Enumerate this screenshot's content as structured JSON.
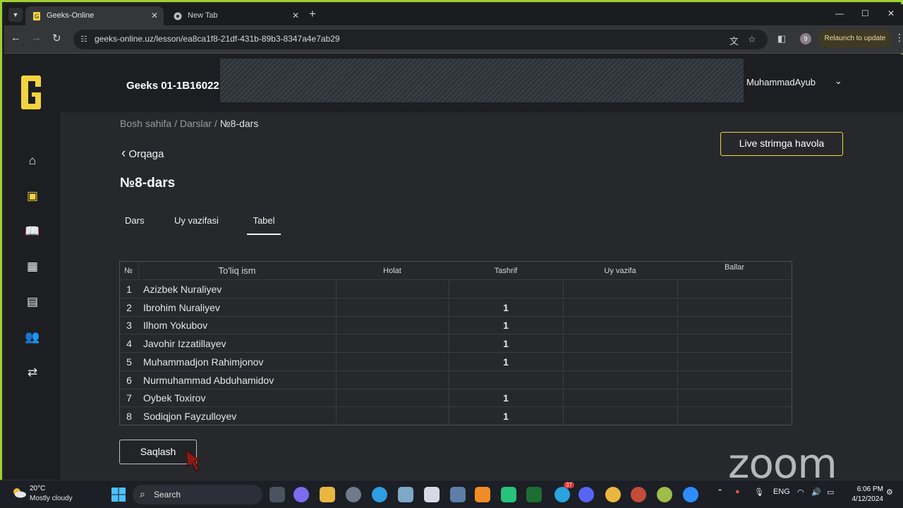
{
  "browser": {
    "tabs": [
      {
        "title": "Geeks-Online",
        "active": true
      },
      {
        "title": "New Tab",
        "active": false
      }
    ],
    "url": "geeks-online.uz/lesson/ea8ca1f8-21df-431b-89b3-8347a4e7ab29",
    "profile_badge": "9",
    "relaunch_label": "Relaunch to update"
  },
  "header": {
    "group_name": "Geeks 01-1B16022",
    "username": "MuhammadAyub"
  },
  "breadcrumb": {
    "home": "Bosh sahifa",
    "lessons": "Darslar",
    "current": "№8-dars",
    "separator": "/"
  },
  "live_button_label": "Live strimga havola",
  "back_label": "Orqaga",
  "lesson_title": "№8-dars",
  "tabs": [
    {
      "label": "Dars"
    },
    {
      "label": "Uy vazifasi"
    },
    {
      "label": "Tabel",
      "selected": true
    }
  ],
  "table": {
    "headers": {
      "num": "№",
      "name": "To'liq ism",
      "status": "Holat",
      "attendance": "Tashrif",
      "homework": "Uy vazifa",
      "points": "Ballar"
    },
    "rows": [
      {
        "num": "1",
        "name": "Azizbek Nuraliyev",
        "attendance": ""
      },
      {
        "num": "2",
        "name": "Ibrohim Nuraliyev",
        "attendance": "1"
      },
      {
        "num": "3",
        "name": "Ilhom Yokubov",
        "attendance": "1"
      },
      {
        "num": "4",
        "name": "Javohir Izzatillayev",
        "attendance": "1"
      },
      {
        "num": "5",
        "name": "Muhammadjon Rahimjonov",
        "attendance": "1"
      },
      {
        "num": "6",
        "name": "Nurmuhammad Abduhamidov",
        "attendance": ""
      },
      {
        "num": "7",
        "name": "Oybek Toxirov",
        "attendance": "1"
      },
      {
        "num": "8",
        "name": "Sodiqjon Fayzulloyev",
        "attendance": "1"
      }
    ]
  },
  "save_label": "Saqlash",
  "watermark": "zoom",
  "taskbar": {
    "weather_temp": "20°C",
    "weather_cond": "Mostly cloudy",
    "search_label": "Search",
    "language": "ENG",
    "time": "6:06 PM",
    "date": "4/12/2024",
    "telegram_badge": "37"
  },
  "colors": {
    "accent": "#f3d33e",
    "frame": "#9fd130",
    "background": "#27282c"
  }
}
